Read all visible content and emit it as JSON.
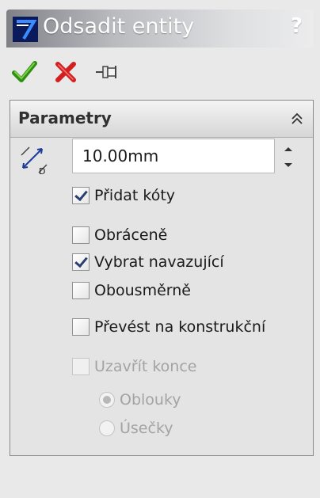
{
  "titlebar": {
    "title": "Odsadit entity",
    "help_label": "?"
  },
  "toolbar": {
    "ok_icon": "checkmark-icon",
    "cancel_icon": "x-icon",
    "pin_icon": "pushpin-icon"
  },
  "group": {
    "title": "Parametry",
    "distance": {
      "value": "10.00mm"
    },
    "options": [
      {
        "label": "Přidat kóty",
        "checked": true
      },
      {
        "label": "Obráceně",
        "checked": false
      },
      {
        "label": "Vybrat navazující",
        "checked": true
      },
      {
        "label": "Obousměrně",
        "checked": false
      },
      {
        "label": "Převést na konstrukční",
        "checked": false
      },
      {
        "label": "Uzavřít konce",
        "checked": false,
        "disabled": true
      }
    ],
    "cap_type": [
      {
        "label": "Oblouky",
        "selected": true
      },
      {
        "label": "Úsečky",
        "selected": false
      }
    ]
  },
  "colors": {
    "ok_green": "#2e8f12",
    "cancel_red": "#d21f1f",
    "title_icon_blue": "#1f3fa0"
  }
}
